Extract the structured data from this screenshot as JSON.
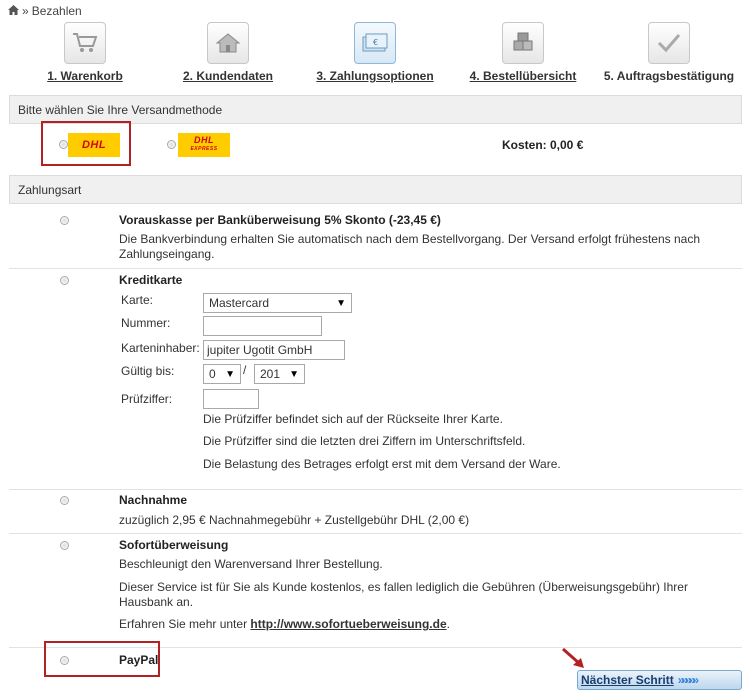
{
  "breadcrumb": {
    "separator": "»",
    "current": "Bezahlen"
  },
  "steps": [
    {
      "label": "1. Warenkorb",
      "icon": "cart-icon"
    },
    {
      "label": "2. Kundendaten",
      "icon": "house-icon"
    },
    {
      "label": "3. Zahlungsoptionen",
      "icon": "money-icon"
    },
    {
      "label": "4. Bestellübersicht",
      "icon": "boxes-icon"
    },
    {
      "label": "5. Auftragsbestätigung",
      "icon": "checkmark-icon"
    }
  ],
  "shipping": {
    "header": "Bitte wählen Sie Ihre Versandmethode",
    "option1_logo": "DHL",
    "option2_logo": "DHL",
    "option2_sub": "EXPRESS",
    "cost": "Kosten: 0,00 €"
  },
  "payment": {
    "header": "Zahlungsart",
    "prepay": {
      "title": "Vorauskasse per Banküberweisung 5% Skonto (-23,45 €)",
      "desc": "Die Bankverbindung erhalten Sie automatisch nach dem Bestellvorgang. Der Versand erfolgt frühestens nach Zahlungseingang."
    },
    "card": {
      "title": "Kreditkarte",
      "type_label": "Karte:",
      "type_value": "Mastercard",
      "number_label": "Nummer:",
      "number_value": "",
      "holder_label": "Karteninhaber:",
      "holder_value": "jupiter Ugotit GmbH",
      "valid_label": "Gültig bis:",
      "month_value": "0",
      "slash": "/",
      "year_value": "201",
      "cvc_label": "Prüfziffer:",
      "cvc_value": "",
      "note1": "Die Prüfziffer befindet sich auf der Rückseite Ihrer Karte.",
      "note2": "Die Prüfziffer sind die letzten drei Ziffern im Unterschriftsfeld.",
      "note3": "Die Belastung des Betrages erfolgt erst mit dem Versand der Ware."
    },
    "cod": {
      "title": "Nachnahme",
      "desc": "zuzüglich 2,95 € Nachnahmegebühr + Zustellgebühr DHL (2,00 €)"
    },
    "sofort": {
      "title": "Sofortüberweisung",
      "desc1": "Beschleunigt den Warenversand Ihrer Bestellung.",
      "desc2": "Dieser Service ist für Sie als Kunde kostenlos, es fallen lediglich die Gebühren (Überweisungsgebühr) Ihrer Hausbank an.",
      "desc3_prefix": "Erfahren Sie mehr unter",
      "link": "http://www.sofortueberweisung.de",
      "desc3_suffix": "."
    },
    "paypal": {
      "title": "PayPal"
    }
  },
  "next_button": {
    "label": "Nächster Schritt",
    "chevrons": "»»»»»"
  },
  "colors": {
    "highlight_red": "#b22222",
    "dhl_yellow": "#ffcc00",
    "dhl_red": "#d40511",
    "button_blue": "#3a86d4"
  }
}
